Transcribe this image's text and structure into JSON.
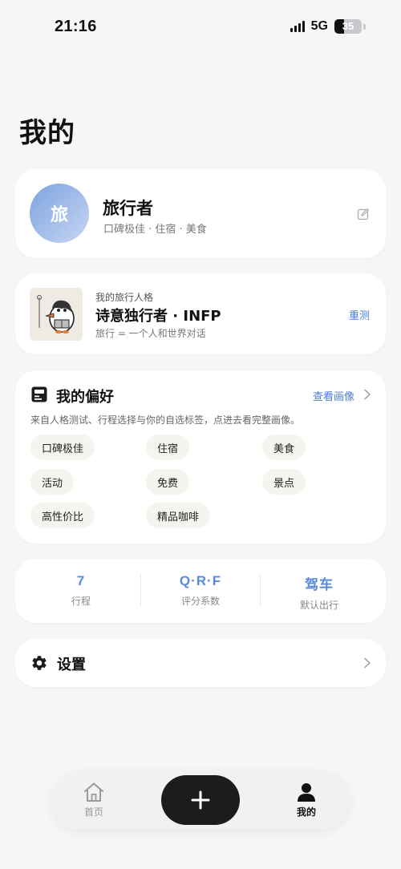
{
  "status_bar": {
    "time": "21:16",
    "network": "5G",
    "battery": "35",
    "battery_fraction": 0.35
  },
  "page": {
    "title": "我的"
  },
  "profile": {
    "avatar_text": "旅",
    "name": "旅行者",
    "tags": "口碑极佳 · 住宿 · 美食",
    "edit_icon": "edit-icon"
  },
  "persona": {
    "caption": "我的旅行人格",
    "title": "诗意独行者 · INFP",
    "subtitle": "旅行 = 一个人和世界对话",
    "retest_label": "重测"
  },
  "preferences": {
    "title": "我的偏好",
    "link_label": "查看画像",
    "description": "来自人格测试、行程选择与你的自选标签，点进去看完整画像。",
    "tags": [
      "口碑极佳",
      "住宿",
      "美食",
      "活动",
      "免费",
      "景点",
      "高性价比",
      "精品咖啡"
    ]
  },
  "stats": [
    {
      "value": "7",
      "label": "行程"
    },
    {
      "value": "Q·R·F",
      "label": "评分系数"
    },
    {
      "value": "驾车",
      "label": "默认出行"
    }
  ],
  "settings": {
    "label": "设置"
  },
  "tabbar": {
    "home_label": "首页",
    "mine_label": "我的",
    "add_icon": "plus-icon"
  },
  "colors": {
    "accent": "#4a7fcf",
    "stat_value": "#5b8bd6",
    "background": "#f6f6f8",
    "card": "#ffffff",
    "tag_bg": "#f6f4ef",
    "add_button": "#1c1c1c"
  }
}
